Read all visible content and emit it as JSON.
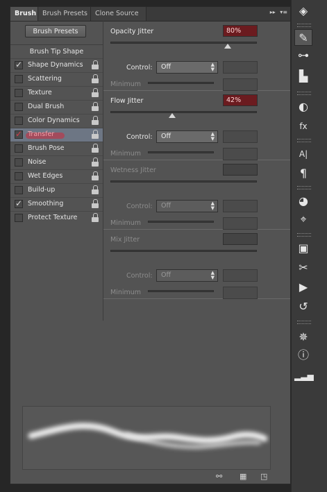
{
  "tabs": [
    "Brush",
    "Brush Presets",
    "Clone Source"
  ],
  "tab_controls": {
    "collapse": "▸▸",
    "menu": "▾≡"
  },
  "left": {
    "presets_button": "Brush Presets",
    "tip_shape": "Brush Tip Shape",
    "options": [
      {
        "label": "Shape Dynamics",
        "checked": true
      },
      {
        "label": "Scattering",
        "checked": false
      },
      {
        "label": "Texture",
        "checked": false
      },
      {
        "label": "Dual Brush",
        "checked": false
      },
      {
        "label": "Color Dynamics",
        "checked": false
      },
      {
        "label": "Transfer",
        "checked": true
      },
      {
        "label": "Brush Pose",
        "checked": false
      },
      {
        "label": "Noise",
        "checked": false
      },
      {
        "label": "Wet Edges",
        "checked": false
      },
      {
        "label": "Build-up",
        "checked": false
      },
      {
        "label": "Smoothing",
        "checked": true
      },
      {
        "label": "Protect Texture",
        "checked": false
      }
    ]
  },
  "sections": [
    {
      "title": "Opacity Jitter",
      "value": "80%",
      "thumb_fraction": 0.8,
      "control_label": "Control:",
      "control_value": "Off",
      "minimum_label": "Minimum"
    },
    {
      "title": "Flow Jitter",
      "value": "42%",
      "thumb_fraction": 0.42,
      "control_label": "Control:",
      "control_value": "Off",
      "minimum_label": "Minimum"
    },
    {
      "title": "Wetness Jitter",
      "value": "",
      "control_label": "Control:",
      "control_value": "Off",
      "minimum_label": "Minimum"
    },
    {
      "title": "Mix Jitter",
      "value": "",
      "control_label": "Control:",
      "control_value": "Off",
      "minimum_label": "Minimum"
    }
  ],
  "dock_icons": [
    "layers-icon",
    "brush-icon",
    "sliders-icon",
    "clone-stamp-icon",
    "circle-slash-icon",
    "fx-icon",
    "character-icon",
    "paragraph-icon",
    "channels-icon",
    "paths-icon",
    "3d-icon",
    "tool-presets-icon",
    "play-icon",
    "history-icon",
    "compass-icon",
    "info-icon",
    "histogram-icon"
  ],
  "colors": {
    "accent_red": "#6b1b1f",
    "selected_row": "#6d7684"
  }
}
